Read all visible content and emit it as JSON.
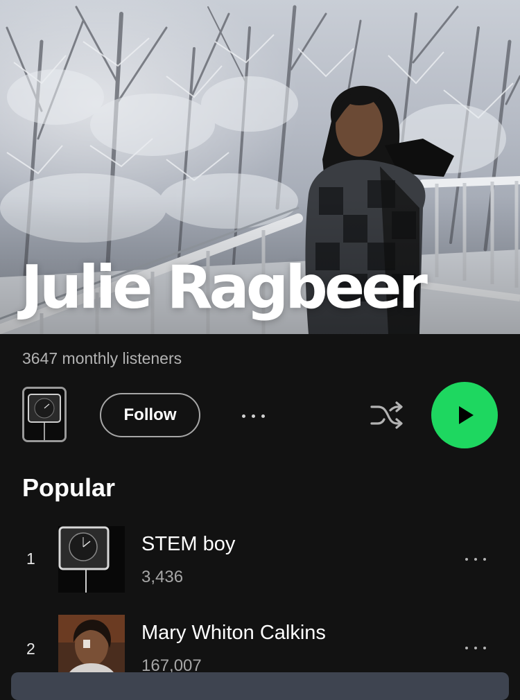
{
  "artist": {
    "name": "Julie Ragbeer",
    "monthly_listeners": "3647 monthly listeners"
  },
  "actions": {
    "follow_label": "Follow"
  },
  "popular": {
    "title": "Popular",
    "tracks": [
      {
        "rank": "1",
        "title": "STEM boy",
        "plays": "3,436"
      },
      {
        "rank": "2",
        "title": "Mary Whiton Calkins",
        "plays": "167,007"
      }
    ]
  },
  "colors": {
    "background": "#121212",
    "accent_green": "#1ed760",
    "secondary_text": "#b3b3b3"
  },
  "icons": {
    "shuffle": "shuffle-icon",
    "play": "play-icon",
    "more": "more-options-icon"
  }
}
